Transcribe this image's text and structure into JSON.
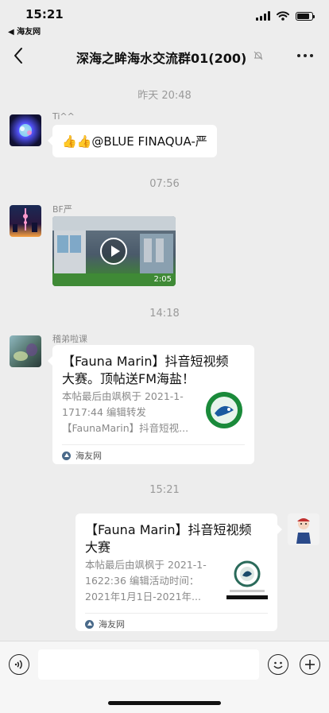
{
  "status_bar": {
    "time": "15:21",
    "back_app": "◀ 海友网",
    "battery_level": 0.85
  },
  "nav": {
    "title": "深海之眸海水交流群01(200)",
    "back_icon": "chevron-left-icon",
    "mute_icon": "bell-off-icon",
    "more_icon": "more-dots-icon"
  },
  "messages": [
    {
      "type": "timestamp",
      "text": "昨天 20:48"
    },
    {
      "type": "text",
      "side": "left",
      "sender": "Ti^^",
      "text": "👍👍@BLUE FINAQUA-严"
    },
    {
      "type": "timestamp",
      "text": "07:56"
    },
    {
      "type": "video",
      "side": "left",
      "sender": "BF严",
      "duration": "2:05"
    },
    {
      "type": "timestamp",
      "text": "14:18"
    },
    {
      "type": "link",
      "side": "left",
      "sender": "稽弟啦课",
      "title": "【Fauna Marin】抖音短视频大赛。顶帖送FM海盐！",
      "desc": "本帖最后由飒枫于 2021-1-1717:44 编辑转发【FaunaMarin】抖音短视...",
      "source": "海友网"
    },
    {
      "type": "timestamp",
      "text": "15:21"
    },
    {
      "type": "link",
      "side": "right",
      "title": "【Fauna Marin】抖音短视频大赛",
      "desc": "本帖最后由飒枫于 2021-1-1622:36 编辑活动时间：2021年1月1日-2021年...",
      "source": "海友网"
    }
  ],
  "input_bar": {
    "voice_icon": "voice-icon",
    "emoji_icon": "emoji-icon",
    "add_icon": "plus-icon"
  }
}
